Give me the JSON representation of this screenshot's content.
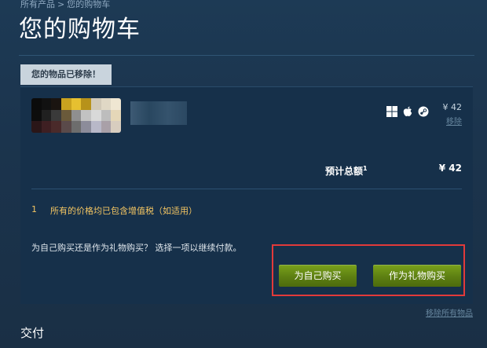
{
  "breadcrumb": {
    "root": "所有产品",
    "separator": ">",
    "current": "您的购物车"
  },
  "page_title": "您的购物车",
  "notice": "您的物品已移除！",
  "cart_item": {
    "platforms": [
      "windows-icon",
      "apple-icon",
      "steam-icon"
    ],
    "price": "¥ 42",
    "remove": "移除"
  },
  "summary": {
    "estimated_label": "预计总额",
    "footnote": "1",
    "estimated_price": "¥ 42",
    "vat_number": "1",
    "vat_text": "所有的价格均已包含增值税（如适用）",
    "purchase_question": "为自己购买还是作为礼物购买？ 选择一项以继续付款。",
    "buy_self": "为自己购买",
    "buy_gift": "作为礼物购买"
  },
  "remove_all": "移除所有物品",
  "payment_heading": "交付",
  "colors": {
    "accent_button": "#5d7f12",
    "highlight": "#e23a3a",
    "notice_bg": "#c9d4dd"
  }
}
